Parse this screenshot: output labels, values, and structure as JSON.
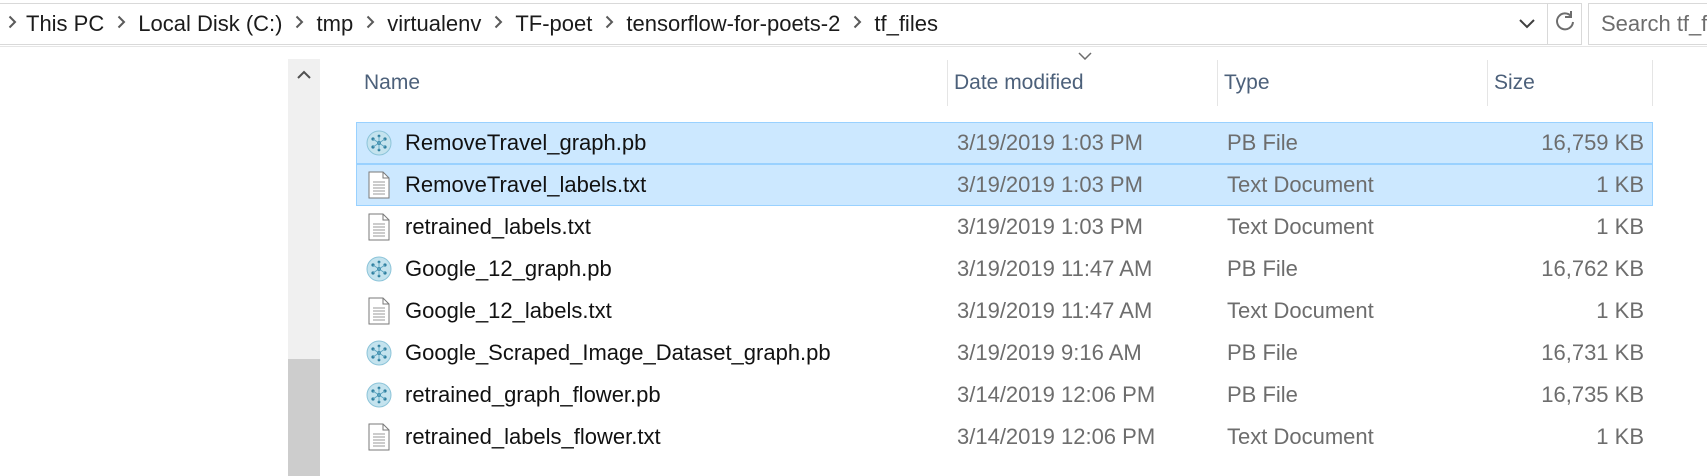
{
  "address_bar": {
    "breadcrumbs": [
      "This PC",
      "Local Disk (C:)",
      "tmp",
      "virtualenv",
      "TF-poet",
      "tensorflow-for-poets-2",
      "tf_files"
    ],
    "chevron_icon": "chevron-down-icon",
    "refresh_icon": "refresh-icon"
  },
  "search": {
    "placeholder": "Search tf_files"
  },
  "columns": {
    "name": "Name",
    "date": "Date modified",
    "type": "Type",
    "size": "Size"
  },
  "files": [
    {
      "name": "RemoveTravel_graph.pb",
      "date": "3/19/2019 1:03 PM",
      "type": "PB File",
      "size": "16,759 KB",
      "icon": "pb-file-icon",
      "selected": true
    },
    {
      "name": "RemoveTravel_labels.txt",
      "date": "3/19/2019 1:03 PM",
      "type": "Text Document",
      "size": "1 KB",
      "icon": "text-file-icon",
      "selected": true
    },
    {
      "name": "retrained_labels.txt",
      "date": "3/19/2019 1:03 PM",
      "type": "Text Document",
      "size": "1 KB",
      "icon": "text-file-icon",
      "selected": false
    },
    {
      "name": "Google_12_graph.pb",
      "date": "3/19/2019 11:47 AM",
      "type": "PB File",
      "size": "16,762 KB",
      "icon": "pb-file-icon",
      "selected": false
    },
    {
      "name": "Google_12_labels.txt",
      "date": "3/19/2019 11:47 AM",
      "type": "Text Document",
      "size": "1 KB",
      "icon": "text-file-icon",
      "selected": false
    },
    {
      "name": "Google_Scraped_Image_Dataset_graph.pb",
      "date": "3/19/2019 9:16 AM",
      "type": "PB File",
      "size": "16,731 KB",
      "icon": "pb-file-icon",
      "selected": false
    },
    {
      "name": "retrained_graph_flower.pb",
      "date": "3/14/2019 12:06 PM",
      "type": "PB File",
      "size": "16,735 KB",
      "icon": "pb-file-icon",
      "selected": false
    },
    {
      "name": "retrained_labels_flower.txt",
      "date": "3/14/2019 12:06 PM",
      "type": "Text Document",
      "size": "1 KB",
      "icon": "text-file-icon",
      "selected": false
    }
  ],
  "colors": {
    "selection_bg": "#cce8ff",
    "selection_border": "#99d1ff",
    "header_text": "#4c607a",
    "meta_text": "#6d6d6d"
  }
}
